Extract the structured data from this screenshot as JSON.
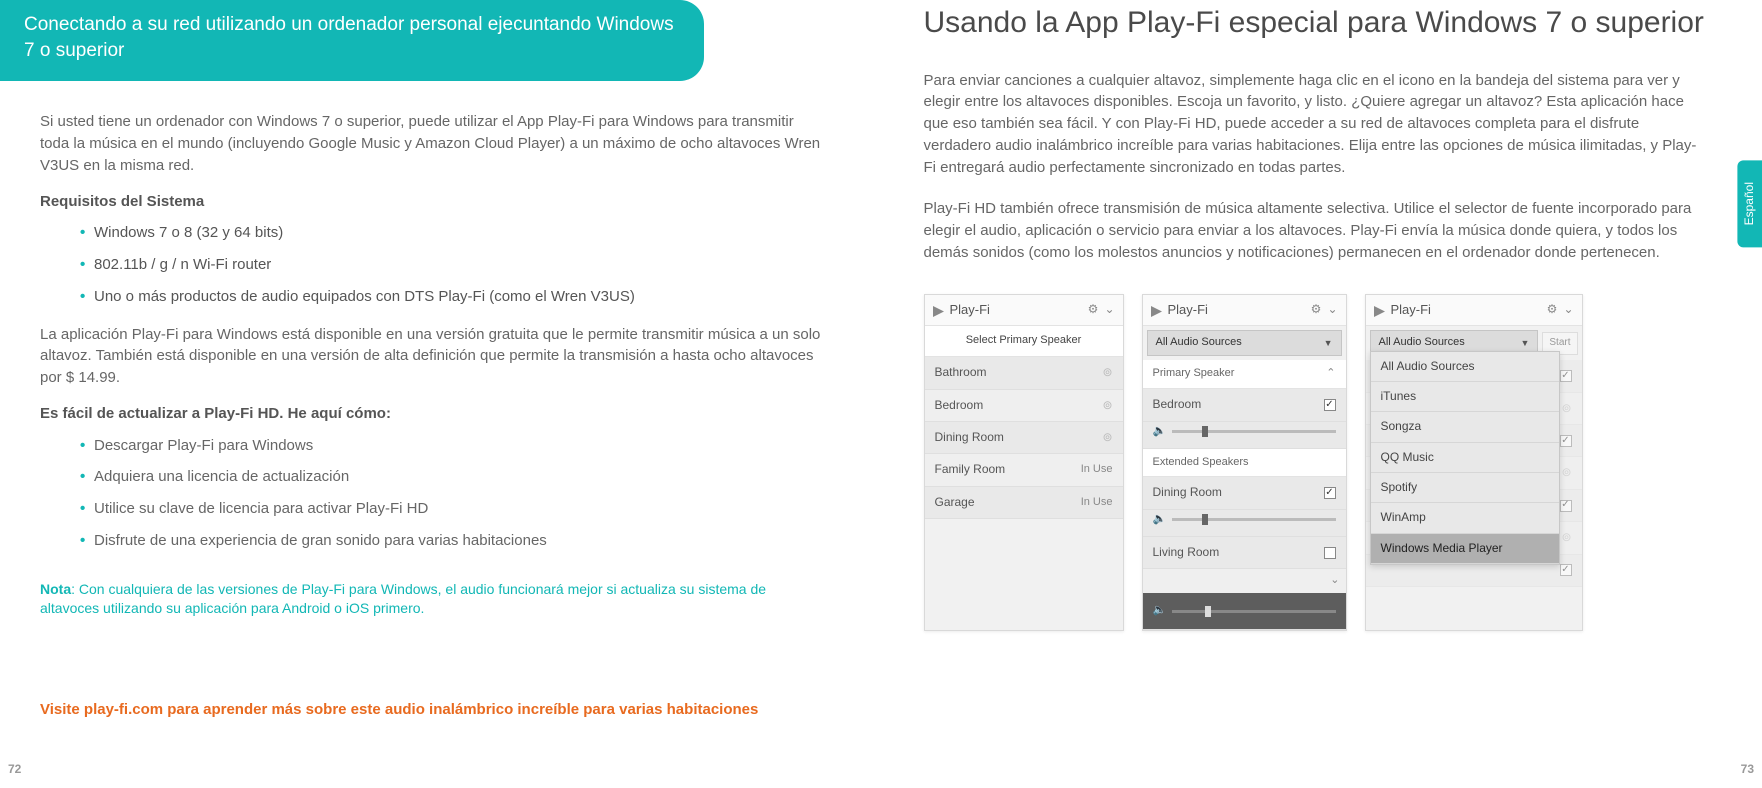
{
  "left": {
    "heading": "Conectando a su red utilizando un ordenador personal ejecuntando Windows 7 o superior",
    "intro": "Si usted tiene un ordenador con Windows 7 o superior, puede utilizar el App Play-Fi para Windows para transmitir toda la música en el mundo (incluyendo Google Music y Amazon Cloud Player) a un máximo de ocho altavoces Wren V3US en la misma red.",
    "req_heading": "Requisitos del Sistema",
    "reqs": [
      "Windows 7 o 8 (32 y 64 bits)",
      "802.11b / g / n Wi-Fi router",
      "Uno o más productos de audio equipados con DTS Play-Fi (como el Wren V3US)"
    ],
    "free_para": "La aplicación Play-Fi para Windows está disponible en una versión gratuita que le permite transmitir música a un solo altavoz. También está disponible en una versión de alta definición que permite la transmisión a hasta ocho altavoces por $ 14.99.",
    "upgrade_heading": "Es fácil de actualizar a Play-Fi HD. He aquí cómo:",
    "steps": [
      "Descargar Play-Fi para Windows",
      "Adquiera una licencia de actualización",
      "Utilice su clave de licencia para activar Play-Fi HD",
      "Disfrute de una experiencia de gran sonido para varias habitaciones"
    ],
    "note_label": "Nota",
    "note_text": ": Con cualquiera de las versiones de Play-Fi para Windows, el audio funcionará mejor si actualiza su sistema de altavoces utilizando su aplicación para Android o iOS primero.",
    "visit": "Visite play-fi.com para aprender más sobre este audio inalámbrico increíble para varias habitaciones",
    "page_num": "72"
  },
  "right": {
    "heading": "Usando la App Play-Fi especial para Windows 7 o superior",
    "p1": "Para enviar canciones a cualquier altavoz, simplemente haga clic en el icono en la bandeja del sistema para ver y elegir entre los altavoces disponibles. Escoja un favorito, y listo. ¿Quiere agregar un altavoz? Esta aplicación hace que eso también sea fácil. Y con Play-Fi HD, puede acceder a su red de altavoces completa para el disfrute verdadero audio inalámbrico increíble para varias habitaciones. Elija entre las opciones de música ilimitadas, y Play-Fi entregará audio perfectamente sincronizado en todas partes.",
    "p2": "Play-Fi HD también ofrece transmisión de música altamente selectiva. Utilice el selector de fuente incorporado para elegir el audio, aplicación o servicio para enviar a los altavoces. Play-Fi envía la música donde quiera, y todos los demás sonidos (como los molestos anuncios y notificaciones) permanecen en el ordenador donde pertenecen.",
    "page_num": "73",
    "lang_tab": "Español"
  },
  "app": {
    "title": "Play-Fi",
    "gear": "⚙",
    "min": "⌄",
    "shot1": {
      "subheader": "Select Primary Speaker",
      "rows": [
        {
          "name": "Bathroom",
          "status": "wifi"
        },
        {
          "name": "Bedroom",
          "status": "wifi"
        },
        {
          "name": "Dining Room",
          "status": "wifi"
        },
        {
          "name": "Family Room",
          "status": "In Use"
        },
        {
          "name": "Garage",
          "status": "In Use"
        }
      ]
    },
    "shot2": {
      "dropdown": "All Audio Sources",
      "section_primary": "Primary Speaker",
      "primary": "Bedroom",
      "section_ext": "Extended Speakers",
      "ext": [
        {
          "name": "Dining Room",
          "checked": true
        },
        {
          "name": "Living Room",
          "checked": false
        }
      ]
    },
    "shot3": {
      "dropdown": "All Audio Sources",
      "start": "Start",
      "menu": [
        "All Audio Sources",
        "iTunes",
        "Songza",
        "QQ Music",
        "Spotify",
        "WinAmp",
        "Windows Media Player"
      ],
      "selected": "Windows Media Player"
    }
  }
}
